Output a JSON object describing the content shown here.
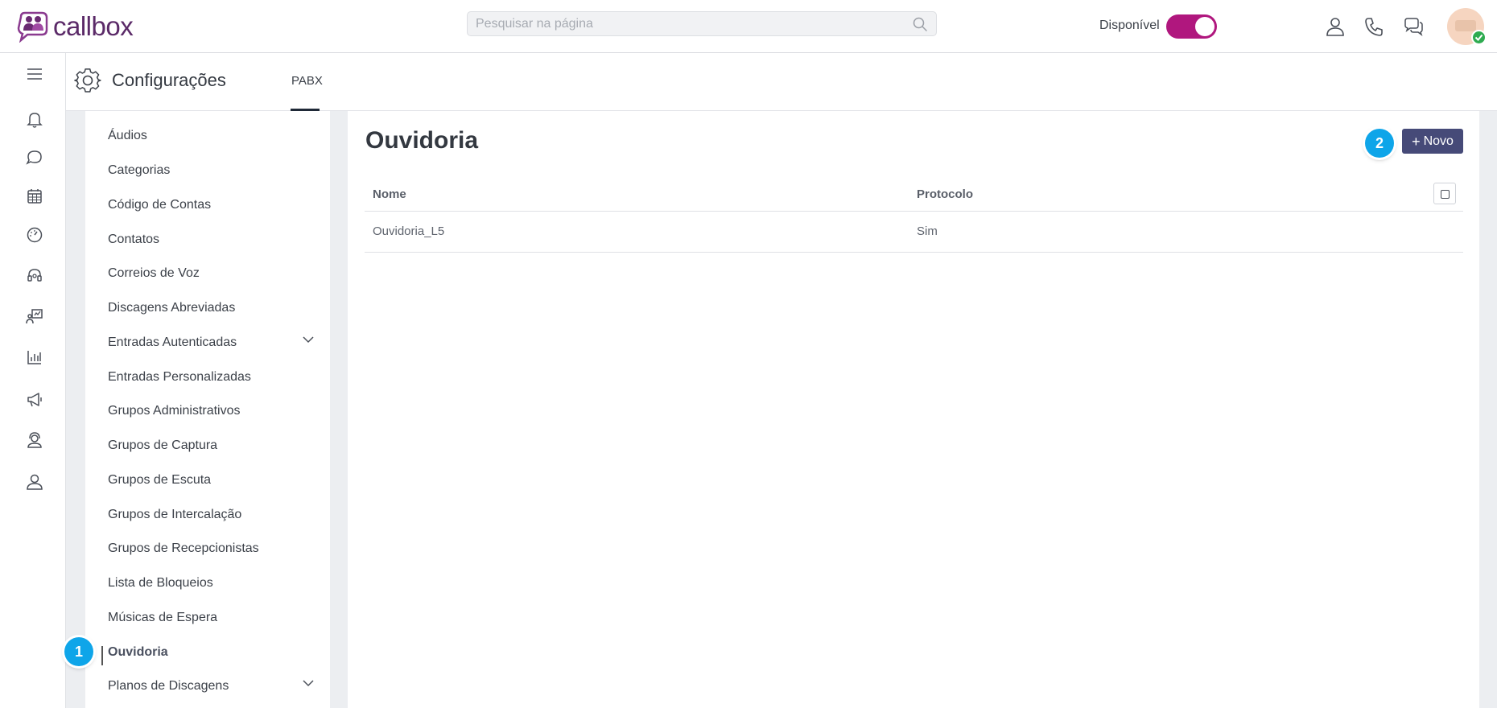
{
  "app": {
    "logo_text": "callbox"
  },
  "search": {
    "placeholder": "Pesquisar na página",
    "value": ""
  },
  "status": {
    "label": "Disponível",
    "enabled": true,
    "toggle_color": "#b0177e"
  },
  "header": {
    "title": "Configurações",
    "tab": "PABX"
  },
  "menu": {
    "items": [
      {
        "label": "Áudios"
      },
      {
        "label": "Categorias"
      },
      {
        "label": "Código de Contas"
      },
      {
        "label": "Contatos"
      },
      {
        "label": "Correios de Voz"
      },
      {
        "label": "Discagens Abreviadas"
      },
      {
        "label": "Entradas Autenticadas"
      },
      {
        "label": "Entradas Personalizadas"
      },
      {
        "label": "Grupos Administrativos"
      },
      {
        "label": "Grupos de Captura"
      },
      {
        "label": "Grupos de Escuta"
      },
      {
        "label": "Grupos de Intercalação"
      },
      {
        "label": "Grupos de Recepcionistas"
      },
      {
        "label": "Lista de Bloqueios"
      },
      {
        "label": "Músicas de Espera"
      },
      {
        "label": "Ouvidoria"
      },
      {
        "label": "Planos de Discagens"
      }
    ],
    "active": "Ouvidoria"
  },
  "content": {
    "title": "Ouvidoria",
    "new_button_label": "Novo",
    "button_color": "#464a78",
    "table": {
      "columns": [
        "Nome",
        "Protocolo"
      ],
      "rows": [
        [
          "Ouvidoria_L5",
          "Sim"
        ]
      ]
    }
  },
  "annotations": {
    "badge1": "1",
    "badge2": "2",
    "badge_color": "#0ea5e9"
  }
}
